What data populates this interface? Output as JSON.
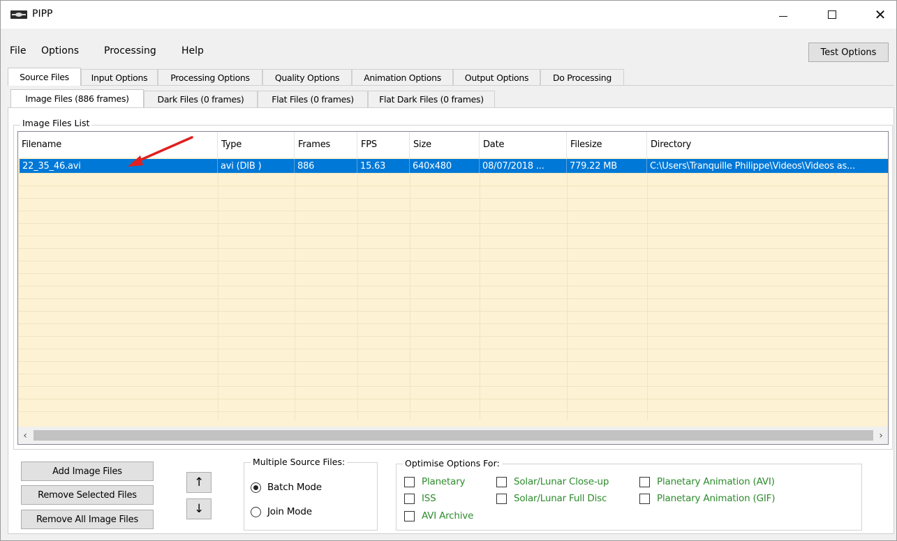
{
  "window": {
    "title": "PIPP",
    "minimize_label": "—",
    "maximize_label": "☐",
    "close_label": "✕"
  },
  "menu": {
    "items": [
      "File",
      "Options",
      "Processing",
      "Help"
    ],
    "test_options": "Test Options"
  },
  "main_tabs": [
    "Source Files",
    "Input Options",
    "Processing Options",
    "Quality Options",
    "Animation Options",
    "Output Options",
    "Do Processing"
  ],
  "sub_tabs": [
    "Image Files (886 frames)",
    "Dark Files (0 frames)",
    "Flat Files (0 frames)",
    "Flat Dark Files (0 frames)"
  ],
  "list": {
    "group_title": "Image Files List",
    "columns": [
      "Filename",
      "Type",
      "Frames",
      "FPS",
      "Size",
      "Date",
      "Filesize",
      "Directory"
    ],
    "rows": [
      [
        "22_35_46.avi",
        "avi (DIB )",
        "886",
        "15.63",
        "640x480",
        "08/07/2018 ...",
        "779.22 MB",
        "C:\\Users\\Tranquille Philippe\\Videos\\Videos as..."
      ]
    ],
    "scroll_left": "‹",
    "scroll_right": "›"
  },
  "buttons": {
    "add": "Add Image Files",
    "remove_selected": "Remove Selected Files",
    "remove_all": "Remove All Image Files",
    "move_up": "↑",
    "move_down": "↓"
  },
  "multiple_source": {
    "title": "Multiple Source Files:",
    "options": [
      "Batch Mode",
      "Join Mode"
    ],
    "selected": "Batch Mode"
  },
  "optimise": {
    "title": "Optimise Options For:",
    "options": [
      "Planetary",
      "ISS",
      "AVI Archive",
      "Solar/Lunar Close-up",
      "Solar/Lunar Full Disc",
      "Planetary Animation (AVI)",
      "Planetary Animation (GIF)"
    ]
  },
  "colors": {
    "selection": "#0078d7",
    "list_background": "#fdf2d4",
    "option_text": "#2e8b2e",
    "annotation_arrow": "#e02020"
  }
}
